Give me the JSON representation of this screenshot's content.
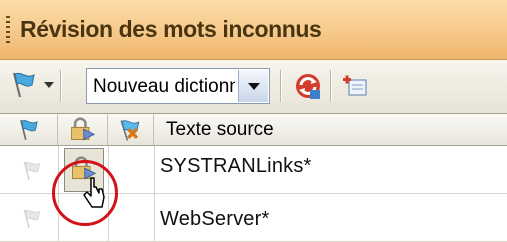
{
  "panel": {
    "title": "Révision des mots inconnus"
  },
  "toolbar": {
    "dictionary_select_value": "Nouveau dictionn"
  },
  "grid": {
    "columns": [
      {
        "label": ""
      },
      {
        "label": ""
      },
      {
        "label": ""
      },
      {
        "label": "Texte source"
      }
    ],
    "rows": [
      {
        "source_text": "SYSTRANLinks*"
      },
      {
        "source_text": "WebServer*"
      }
    ]
  },
  "colors": {
    "title_bar": "#f6c98a",
    "highlight_circle": "#d2121a",
    "toolbar_bg": "#ece9df"
  },
  "icons": [
    "flag-icon",
    "dropdown-arrow-icon",
    "refresh-icon",
    "add-entry-icon",
    "lock-icon",
    "priority-flag-icon",
    "mouse-pointer-icon"
  ]
}
